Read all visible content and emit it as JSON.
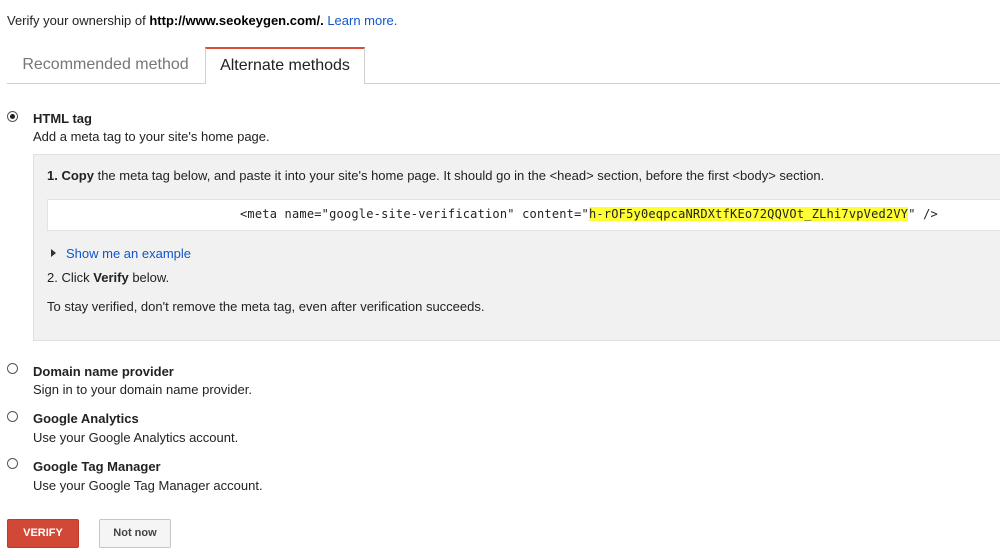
{
  "header": {
    "intro_prefix": "Verify your ownership of",
    "site_url": "http://www.seokeygen.com/.",
    "learn_more": "Learn more."
  },
  "tabs": [
    {
      "label": "Recommended method",
      "active": false
    },
    {
      "label": "Alternate methods",
      "active": true
    }
  ],
  "methods": {
    "html_tag": {
      "title": "HTML tag",
      "desc": "Add a meta tag to your site's home page.",
      "selected": true
    },
    "domain": {
      "title": "Domain name provider",
      "desc": "Sign in to your domain name provider.",
      "selected": false
    },
    "analytics": {
      "title": "Google Analytics",
      "desc": "Use your Google Analytics account.",
      "selected": false
    },
    "tagmanager": {
      "title": "Google Tag Manager",
      "desc": "Use your Google Tag Manager account.",
      "selected": false
    }
  },
  "instructions": {
    "step1_num": "1.",
    "step1_bold": "Copy",
    "step1_rest": "the meta tag below, and paste it into your site's home page. It should go in the <head> section, before the first <body> section.",
    "code_prefix": "<meta name=\"google-site-verification\" content=\"",
    "code_token": "h-rOF5y0eqpcaNRDXtfKEo72QQVOt_ZLhi7vpVed2VY",
    "code_suffix": "\" />",
    "show_example": "Show me an example",
    "step2_num": "2.",
    "step2_pre": "Click",
    "step2_bold": "Verify",
    "step2_post": "below.",
    "note": "To stay verified, don't remove the meta tag, even after verification succeeds."
  },
  "buttons": {
    "verify": "VERIFY",
    "not_now": "Not now"
  },
  "colors": {
    "accent_red": "#d14836",
    "link_blue": "#1155cc",
    "highlight": "#ffff33"
  }
}
